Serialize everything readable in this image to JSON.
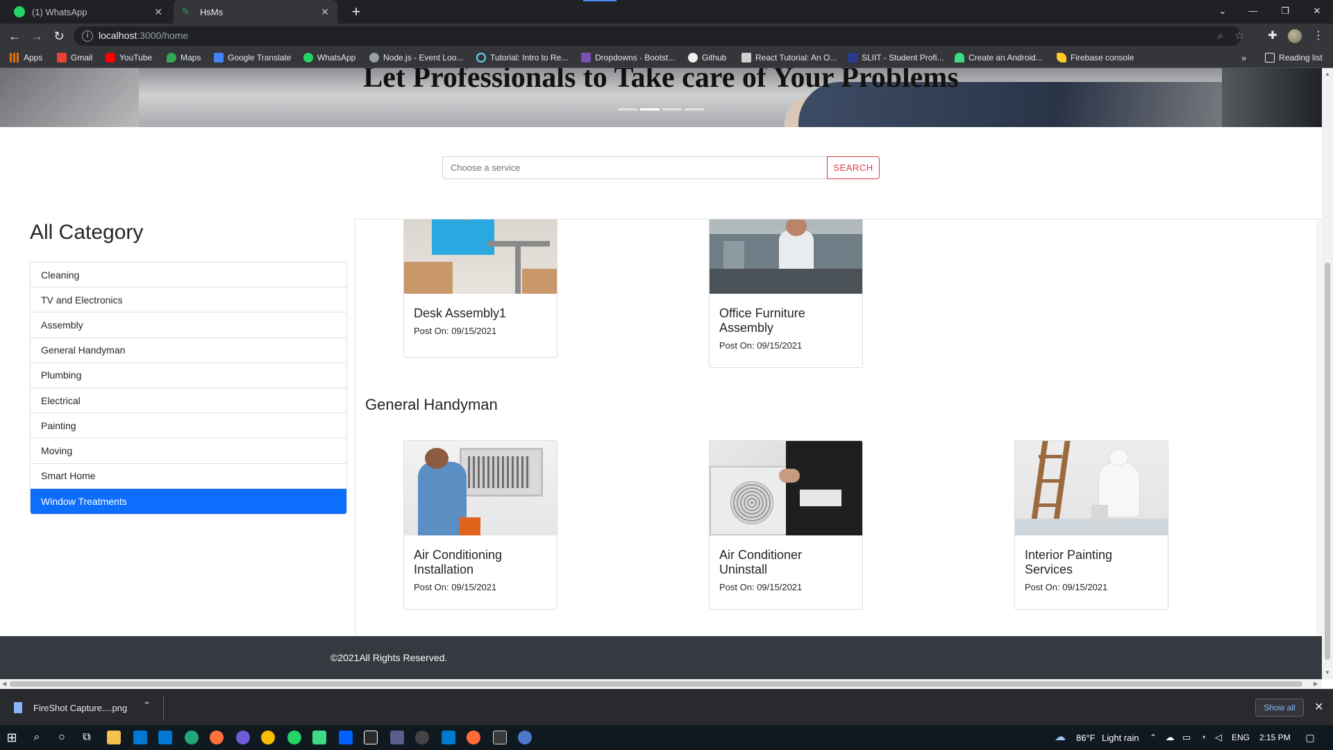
{
  "browser": {
    "tabs": [
      {
        "title": "(1) WhatsApp",
        "active": false
      },
      {
        "title": "HsMs",
        "active": true
      }
    ],
    "url_host": "localhost",
    "url_path": ":3000/home",
    "bookmarks": [
      {
        "label": "Apps",
        "color": "#e8710a"
      },
      {
        "label": "Gmail",
        "color": "#ea4335"
      },
      {
        "label": "YouTube",
        "color": "#ff0000"
      },
      {
        "label": "Maps",
        "color": "#34a853"
      },
      {
        "label": "Google Translate",
        "color": "#4285f4"
      },
      {
        "label": "WhatsApp",
        "color": "#25d366"
      },
      {
        "label": "Node.js - Event Loo...",
        "color": "#9aa0a6"
      },
      {
        "label": "Tutorial: Intro to Re...",
        "color": "#61dafb"
      },
      {
        "label": "Dropdowns · Bootst...",
        "color": "#7952b3"
      },
      {
        "label": "Github",
        "color": "#f0f0f0"
      },
      {
        "label": "React Tutorial: An O...",
        "color": "#d0d0d0"
      },
      {
        "label": "SLIIT - Student Profi...",
        "color": "#2b3a8c"
      },
      {
        "label": "Create an Android...",
        "color": "#3ddc84"
      },
      {
        "label": "Firebase console",
        "color": "#ffca28"
      }
    ],
    "reading_list": "Reading list"
  },
  "page": {
    "hero_title": "Let Professionals to Take care of Your Problems",
    "search": {
      "placeholder": "Choose a service",
      "button": "SEARCH"
    },
    "sidebar": {
      "title": "All Category",
      "items": [
        {
          "label": "Cleaning",
          "active": false
        },
        {
          "label": "TV and Electronics",
          "active": false
        },
        {
          "label": "Assembly",
          "active": false
        },
        {
          "label": "General Handyman",
          "active": false
        },
        {
          "label": "Plumbing",
          "active": false
        },
        {
          "label": "Electrical",
          "active": false
        },
        {
          "label": "Painting",
          "active": false
        },
        {
          "label": "Moving",
          "active": false
        },
        {
          "label": "Smart Home",
          "active": false
        },
        {
          "label": "Window Treatments",
          "active": true
        }
      ]
    },
    "assembly_cards": [
      {
        "title": "Desk Assembly1",
        "date": "Post On: 09/15/2021"
      },
      {
        "title": "Office Furniture Assembly",
        "date": "Post On: 09/15/2021"
      }
    ],
    "general_handyman": {
      "title": "General Handyman",
      "cards": [
        {
          "title": "Air Conditioning Installation",
          "date": "Post On: 09/15/2021"
        },
        {
          "title": "Air Conditioner Uninstall",
          "date": "Post On: 09/15/2021"
        },
        {
          "title": "Interior Painting Services",
          "date": "Post On: 09/15/2021"
        }
      ]
    },
    "footer": "©2021All Rights Reserved."
  },
  "downloads": {
    "file": "FireShot Capture....png",
    "show_all": "Show all"
  },
  "taskbar": {
    "weather_temp": "86°F",
    "weather_desc": "Light rain",
    "lang": "ENG",
    "time": "2:15 PM"
  }
}
